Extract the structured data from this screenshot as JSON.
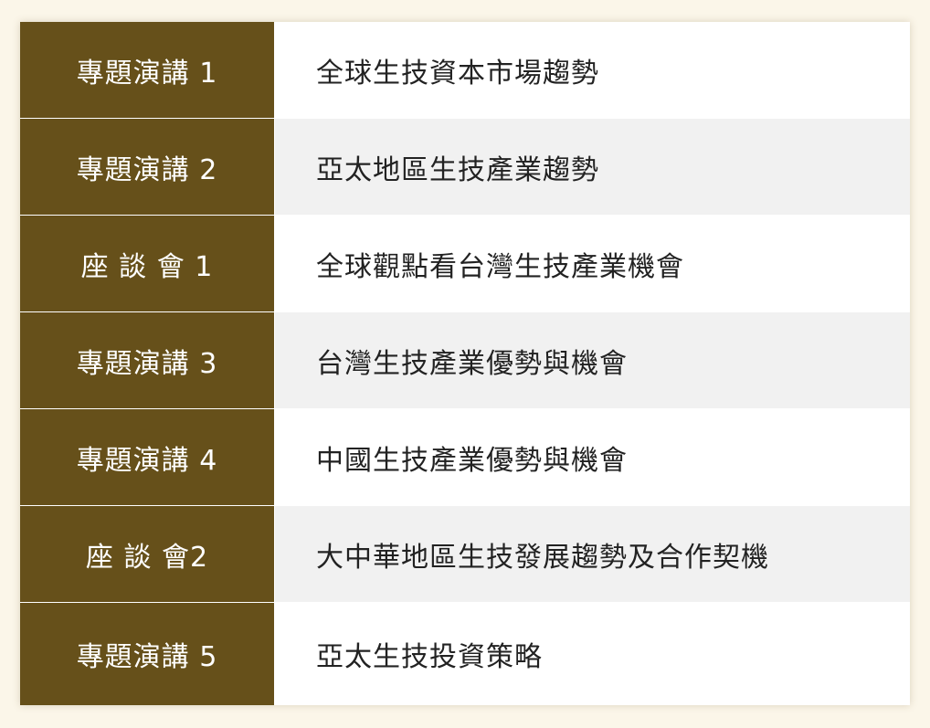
{
  "agenda": {
    "rows": [
      {
        "label": "專題演講 1",
        "topic": "全球生技資本市場趨勢"
      },
      {
        "label": "專題演講 2",
        "topic": "亞太地區生技產業趨勢"
      },
      {
        "label": "座 談 會 1",
        "topic": "全球觀點看台灣生技產業機會"
      },
      {
        "label": "專題演講 3",
        "topic": "台灣生技產業優勢與機會"
      },
      {
        "label": "專題演講 4",
        "topic": "中國生技產業優勢與機會"
      },
      {
        "label": "座 談 會2",
        "topic": "大中華地區生技發展趨勢及合作契機"
      },
      {
        "label": "專題演講 5",
        "topic": "亞太生技投資策略"
      }
    ]
  },
  "colors": {
    "label_background": "#66501a",
    "alt_row_background": "#f1f1f1",
    "page_background": "#fbf6e9"
  }
}
